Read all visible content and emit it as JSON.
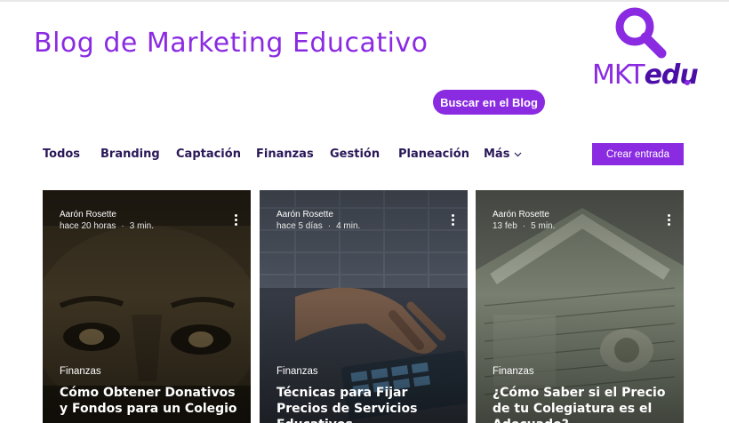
{
  "header": {
    "site_title": "Blog de Marketing Educativo",
    "logo_text_a": "MKT",
    "logo_text_b": "edu",
    "search_button": "Buscar en el Blog"
  },
  "colors": {
    "brand_purple": "#8a2be2",
    "brand_dark": "#4b0fa8",
    "nav_text": "#2a1858"
  },
  "nav": {
    "items": [
      "Todos",
      "Branding",
      "Captación",
      "Finanzas",
      "Gestión",
      "Planeación"
    ],
    "more_label": "Más",
    "create_button": "Crear entrada"
  },
  "posts": [
    {
      "author": "Aarón Rosette",
      "time": "hace 20 horas",
      "read": "3 min.",
      "category": "Finanzas",
      "title": "Cómo Obtener Donativos y Fondos para un Colegio",
      "image": "dollar-bill-face"
    },
    {
      "author": "Aarón Rosette",
      "time": "hace 5 días",
      "read": "4 min.",
      "category": "Finanzas",
      "title": "Técnicas para Fijar Precios de Servicios Educativos",
      "image": "hand-on-calculator"
    },
    {
      "author": "Aarón Rosette",
      "time": "13 feb",
      "read": "5 min.",
      "category": "Finanzas",
      "title": "¿Cómo Saber si el Precio de tu Colegiatura es el Adecuado?",
      "image": "money-house"
    }
  ]
}
